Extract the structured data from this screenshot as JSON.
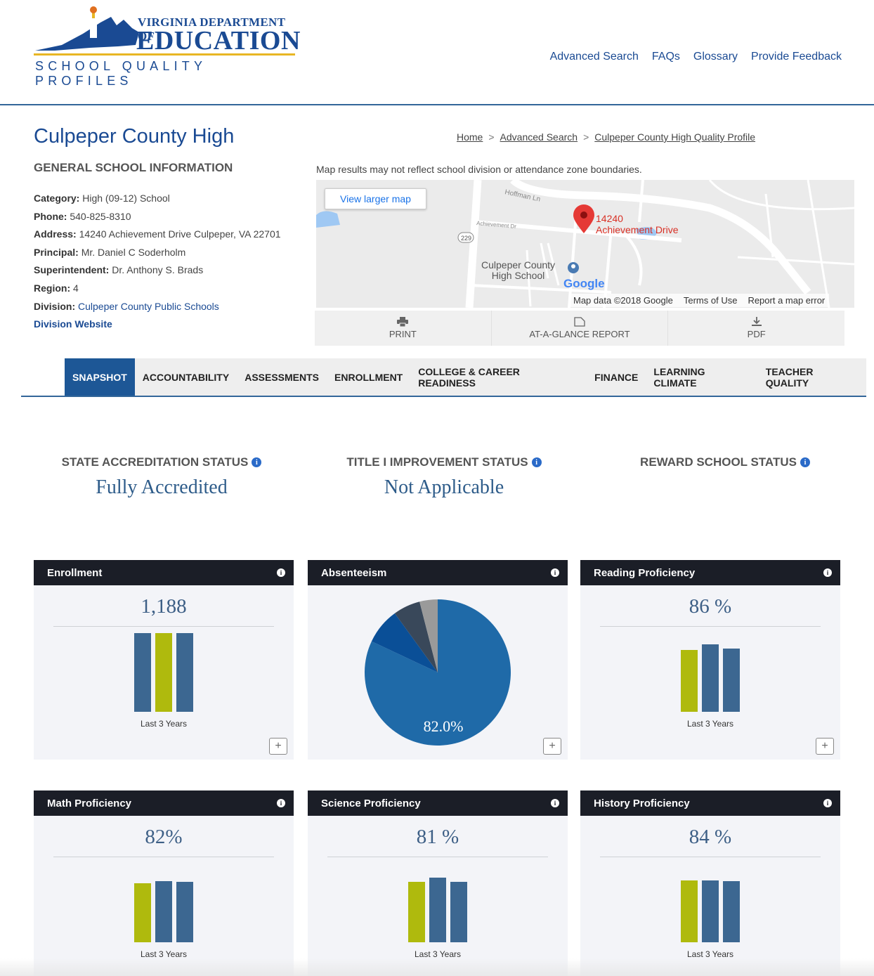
{
  "logo": {
    "org_line1": "Virginia Department of",
    "org_line2": "Education",
    "subtitle": "SCHOOL QUALITY PROFILES"
  },
  "top_nav": [
    "Advanced Search",
    "FAQs",
    "Glossary",
    "Provide Feedback"
  ],
  "school": {
    "name": "Culpeper County High",
    "section_title": "GENERAL SCHOOL INFORMATION",
    "category_label": "Category:",
    "category": "High (09-12) School",
    "phone_label": "Phone:",
    "phone": "540-825-8310",
    "address_label": "Address:",
    "address": "14240 Achievement Drive Culpeper, VA 22701",
    "principal_label": "Principal:",
    "principal": "Mr. Daniel C Soderholm",
    "superintendent_label": "Superintendent:",
    "superintendent": "Dr. Anthony S. Brads",
    "region_label": "Region:",
    "region": "4",
    "division_label": "Division:",
    "division": "Culpeper County Public Schools",
    "division_website": "Division Website"
  },
  "breadcrumb": {
    "home": "Home",
    "sep": ">",
    "advanced": "Advanced Search",
    "current": "Culpeper County High Quality Profile"
  },
  "map": {
    "note": "Map results may not reflect school division or attendance zone boundaries.",
    "view_larger": "View larger map",
    "pin_line1": "14240",
    "pin_line2": "Achievement Drive",
    "school_line1": "Culpeper County",
    "school_line2": "High School",
    "google": "Google",
    "map_data": "Map data ©2018 Google",
    "terms": "Terms of Use",
    "report": "Report a map error",
    "road1": "Hoffman Ln",
    "road2": "Achievement Dr",
    "route": "229"
  },
  "report_bar": {
    "print": "PRINT",
    "glance": "AT-A-GLANCE REPORT",
    "pdf": "PDF"
  },
  "tabs": [
    {
      "label": "SNAPSHOT",
      "active": true
    },
    {
      "label": "ACCOUNTABILITY",
      "active": false
    },
    {
      "label": "ASSESSMENTS",
      "active": false
    },
    {
      "label": "ENROLLMENT",
      "active": false
    },
    {
      "label": "COLLEGE & CAREER READINESS",
      "active": false
    },
    {
      "label": "FINANCE",
      "active": false
    },
    {
      "label": "LEARNING CLIMATE",
      "active": false
    },
    {
      "label": "TEACHER QUALITY",
      "active": false
    }
  ],
  "statuses": {
    "accreditation_label": "STATE ACCREDITATION STATUS",
    "accreditation_value": "Fully Accredited",
    "title1_label": "TITLE I IMPROVEMENT STATUS",
    "title1_value": "Not Applicable",
    "reward_label": "REWARD SCHOOL STATUS",
    "reward_value": ""
  },
  "cards": {
    "enrollment": {
      "title": "Enrollment",
      "value": "1,188",
      "caption": "Last 3 Years",
      "bars": [
        {
          "v": 1.0,
          "c": "blue"
        },
        {
          "v": 1.0,
          "c": "green"
        },
        {
          "v": 1.0,
          "c": "blue"
        }
      ]
    },
    "absenteeism": {
      "title": "Absenteeism",
      "pie_label": "82.0%",
      "slices": [
        {
          "value": 82.0,
          "color": "#1f6aa8"
        },
        {
          "value": 8.0,
          "color": "#0a4f97"
        },
        {
          "value": 6.0,
          "color": "#39485a"
        },
        {
          "value": 4.0,
          "color": "#9a9a9a"
        }
      ]
    },
    "reading": {
      "title": "Reading Proficiency",
      "value": "86 %",
      "caption": "Last 3 Years",
      "bars": [
        {
          "v": 0.92,
          "c": "green"
        },
        {
          "v": 1.0,
          "c": "blue"
        },
        {
          "v": 0.94,
          "c": "blue"
        }
      ]
    },
    "math": {
      "title": "Math Proficiency",
      "value": "82%",
      "caption": "Last 3 Years",
      "bars": [
        {
          "v": 0.93,
          "c": "green"
        },
        {
          "v": 0.97,
          "c": "blue"
        },
        {
          "v": 0.96,
          "c": "blue"
        }
      ]
    },
    "science": {
      "title": "Science Proficiency",
      "value": "81 %",
      "caption": "Last 3 Years",
      "bars": [
        {
          "v": 0.94,
          "c": "green"
        },
        {
          "v": 1.0,
          "c": "blue"
        },
        {
          "v": 0.93,
          "c": "blue"
        }
      ]
    },
    "history": {
      "title": "History Proficiency",
      "value": "84 %",
      "caption": "Last 3 Years",
      "bars": [
        {
          "v": 0.98,
          "c": "green"
        },
        {
          "v": 0.98,
          "c": "blue"
        },
        {
          "v": 0.97,
          "c": "blue"
        }
      ]
    }
  },
  "colors": {
    "brand": "#1a4a93",
    "tab_active": "#1d5796",
    "bar_blue": "#3c6791",
    "bar_green": "#afba0d",
    "card_head": "#1b1e27"
  }
}
